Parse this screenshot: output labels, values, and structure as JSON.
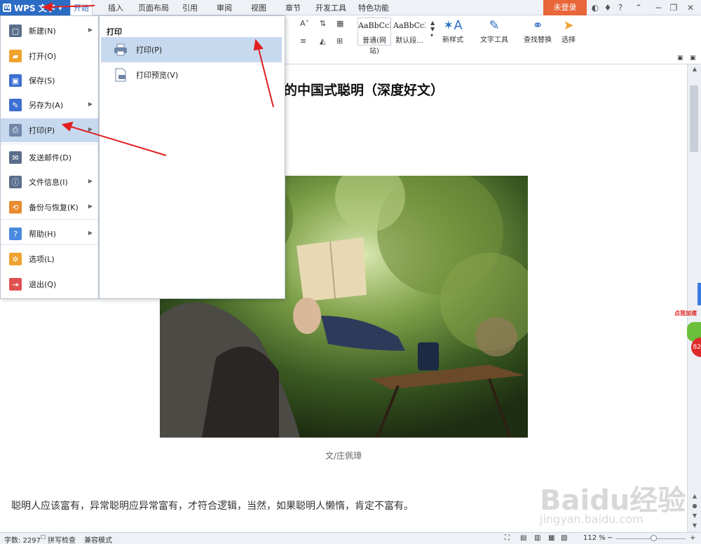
{
  "app": {
    "name": "WPS 文字"
  },
  "tabs": [
    "开始",
    "插入",
    "页面布局",
    "引用",
    "审阅",
    "视图",
    "章节",
    "开发工具",
    "特色功能"
  ],
  "active_tab": "开始",
  "login_label": "未登录",
  "window_controls": [
    "?"
  ],
  "ribbon": {
    "styles": [
      {
        "sample": "AaBbCcD",
        "name": "普通(网站)"
      },
      {
        "sample": "AaBbCcD",
        "name": "默认段..."
      }
    ],
    "new_style": "新样式",
    "text_tools": "文字工具",
    "find_replace": "查找替换",
    "select": "选择"
  },
  "file_menu": {
    "items": [
      {
        "label": "新建(N)",
        "icon": "new-doc-icon",
        "color": "#5a6e8c",
        "submenu": true
      },
      {
        "label": "打开(O)",
        "icon": "folder-icon",
        "color": "#f0a22e",
        "submenu": false
      },
      {
        "label": "保存(S)",
        "icon": "save-icon",
        "color": "#3c6fd1",
        "submenu": false
      },
      {
        "label": "另存为(A)",
        "icon": "save-as-icon",
        "color": "#3c6fd1",
        "submenu": true
      },
      {
        "label": "打印(P)",
        "icon": "printer-icon",
        "color": "#6f86a8",
        "submenu": true
      },
      {
        "label": "发送邮件(D)",
        "icon": "mail-icon",
        "color": "#5a6e8c",
        "submenu": false
      },
      {
        "label": "文件信息(I)",
        "icon": "file-info-icon",
        "color": "#5a6e8c",
        "submenu": true
      },
      {
        "label": "备份与恢复(K)",
        "icon": "backup-icon",
        "color": "#e88a2e",
        "submenu": true
      },
      {
        "label": "帮助(H)",
        "icon": "help-icon",
        "color": "#4a8ae0",
        "submenu": true
      },
      {
        "label": "选项(L)",
        "icon": "gear-icon",
        "color": "#f0a22e",
        "submenu": false
      },
      {
        "label": "退出(Q)",
        "icon": "exit-icon",
        "color": "#e05050",
        "submenu": false
      }
    ],
    "highlighted": "打印(P)"
  },
  "print_submenu": {
    "heading": "打印",
    "items": [
      {
        "label": "打印(P)",
        "icon": "printer-icon"
      },
      {
        "label": "打印预览(V)",
        "icon": "print-preview-icon"
      }
    ]
  },
  "document": {
    "title": "的中国式聪明（深度好文）",
    "caption": "文/庄佩璋",
    "paragraph": "聪明人应该富有，异常聪明应异常富有，才符合逻辑，当然，如果聪明人懒惰，肯定不富有。"
  },
  "status": {
    "word_count": "字数: 2297",
    "spellcheck": "拼写检查",
    "mode": "兼容模式",
    "zoom": "112 %"
  },
  "side_badge": {
    "label": "点我加速",
    "count": "82"
  },
  "watermark": {
    "brand": "Baidu经验",
    "url": "jingyan.baidu.com"
  },
  "colors": {
    "accent": "#2b6cc4",
    "login": "#e8663a",
    "highlight": "#c7d9ef",
    "arrow": "#e02020"
  }
}
